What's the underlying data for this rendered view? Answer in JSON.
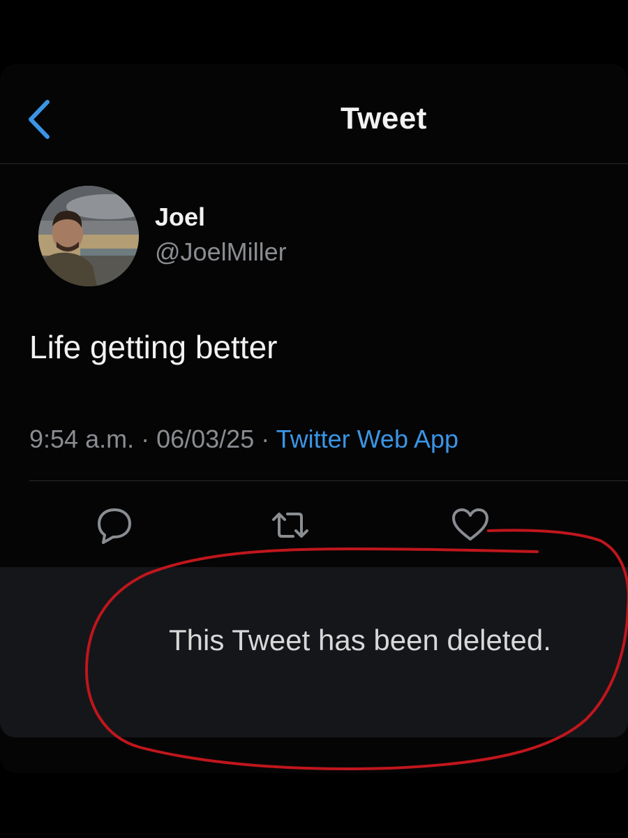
{
  "header": {
    "title": "Tweet"
  },
  "icons": {
    "back": "chevron-left-icon",
    "reply": "reply-icon",
    "retweet": "retweet-icon",
    "like": "heart-icon"
  },
  "tweet": {
    "display_name": "Joel",
    "handle": "@JoelMiller",
    "text": "Life getting better",
    "time": "9:54 a.m.",
    "separator": " · ",
    "date": "06/03/25",
    "source": "Twitter Web App"
  },
  "deleted_notice": "This Tweet has been deleted.",
  "colors": {
    "accent": "#3a95e6",
    "background": "#050505",
    "secondary_text": "#8a8d91",
    "annotation": "#c0161c"
  }
}
